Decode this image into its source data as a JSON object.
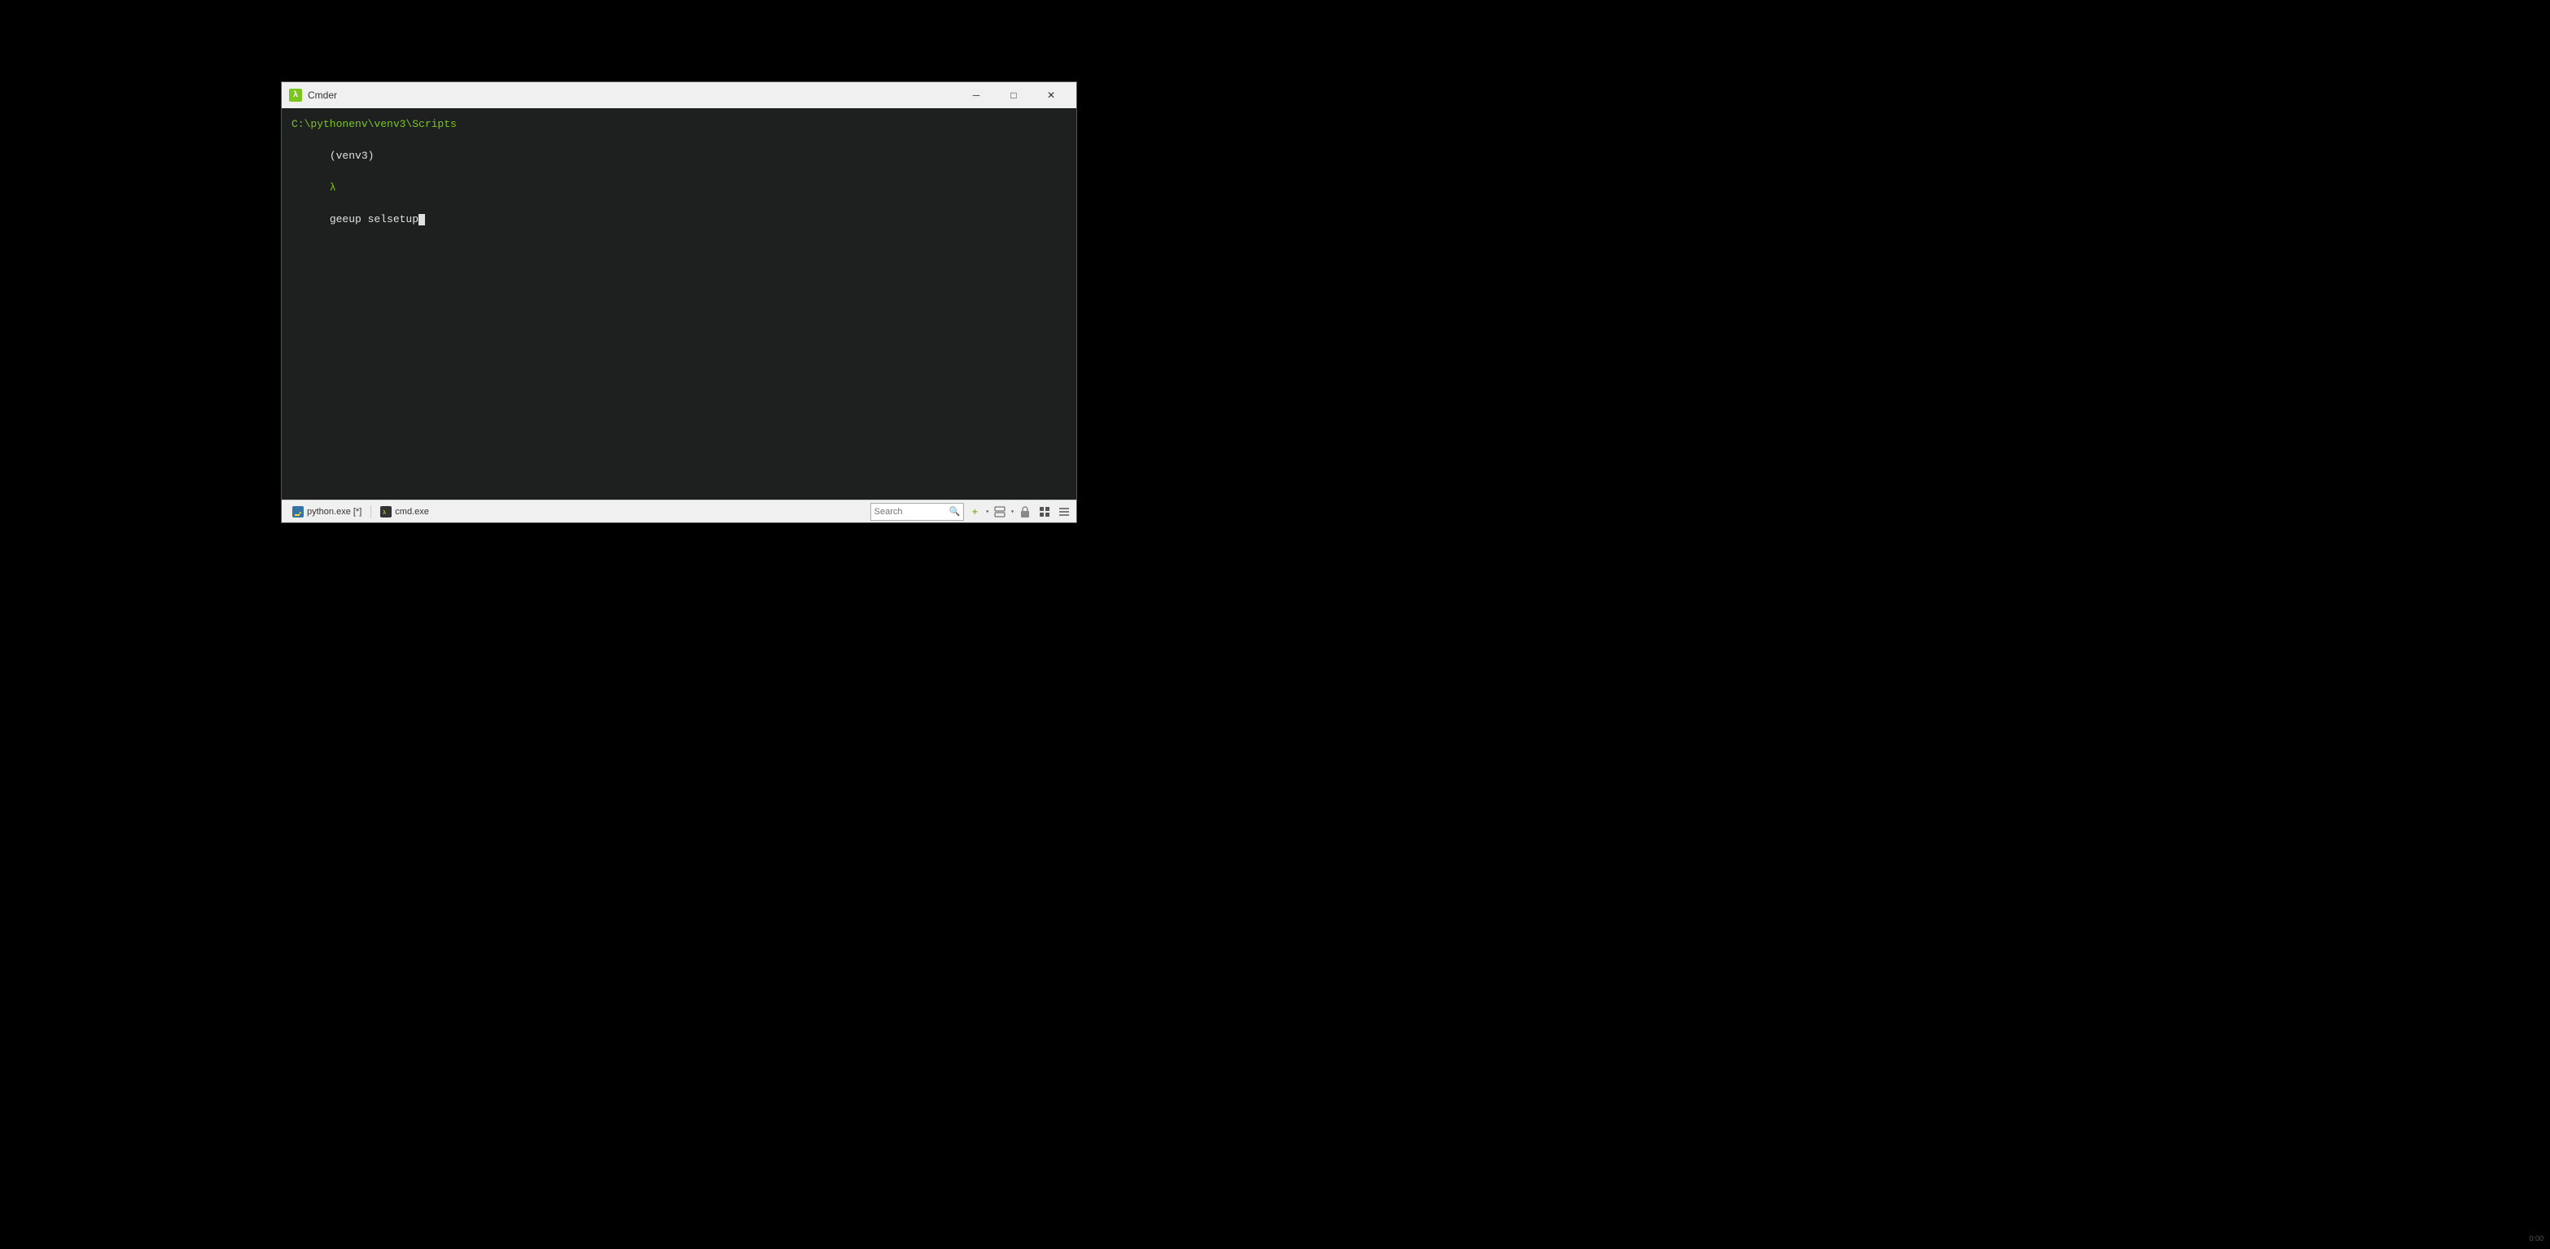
{
  "window": {
    "title": "Cmder",
    "logo_char": "λ"
  },
  "titlebar": {
    "minimize_label": "─",
    "maximize_label": "□",
    "close_label": "✕"
  },
  "terminal": {
    "path_line": "C:\\pythonenv\\venv3\\Scripts",
    "prompt_venv": "(venv3)",
    "prompt_lambda": "λ",
    "prompt_command": "geeup selsetup"
  },
  "statusbar": {
    "tab1_label": "python.exe [*]",
    "tab2_label": "cmd.exe",
    "search_placeholder": "Search",
    "search_icon": "🔍",
    "add_tab_icon": "+",
    "split_h_icon": "⬜",
    "split_v_icon": "⬜",
    "lock_icon": "🔒",
    "layout_icon": "⊞",
    "menu_icon": "≡"
  },
  "clock": {
    "time": "0:00"
  }
}
